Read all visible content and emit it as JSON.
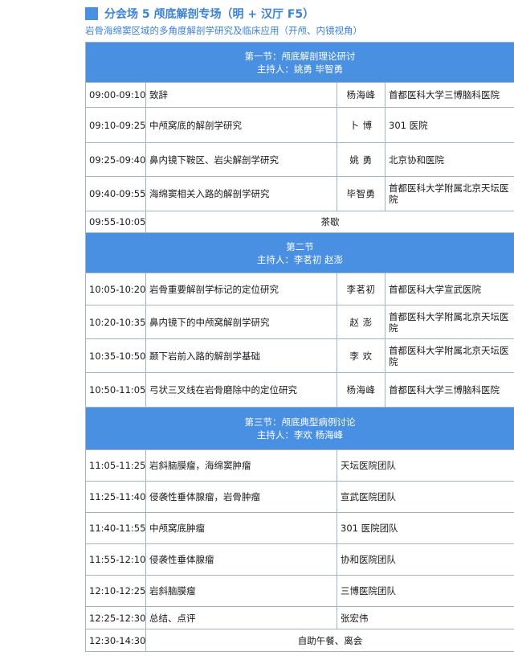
{
  "header": {
    "title": "分会场 5   颅底解剖专场（明 + 汉厅  F5）",
    "subtitle": "岩骨海绵窦区域的多角度解剖学研究及临床应用（开颅、内镜视角）"
  },
  "sections": [
    {
      "title": "第一节：颅底解剖理论研讨",
      "hosts": "主持人：姚勇  毕智勇",
      "rows": [
        {
          "time": "09:00-09:10",
          "topic": "致辞",
          "speaker": "杨海峰",
          "inst": "首都医科大学三博脑科医院"
        },
        {
          "time": "09:10-09:25",
          "topic": "中颅窝底的解剖学研究",
          "speaker": "卜  博",
          "inst": "301 医院"
        },
        {
          "time": "09:25-09:40",
          "topic": "鼻内镜下鞍区、岩尖解剖学研究",
          "speaker": "姚  勇",
          "inst": "北京协和医院"
        },
        {
          "time": "09:40-09:55",
          "topic": "海绵窦相关入路的解剖学研究",
          "speaker": "毕智勇",
          "inst": "首都医科大学附属北京天坛医院"
        }
      ],
      "break": {
        "time": "09:55-10:05",
        "label": "茶歇"
      }
    },
    {
      "title": "第二节",
      "hosts": "主持人：李茗初  赵澎",
      "rows": [
        {
          "time": "10:05-10:20",
          "topic": "岩骨重要解剖学标记的定位研究",
          "speaker": "李茗初",
          "inst": "首都医科大学宣武医院"
        },
        {
          "time": "10:20-10:35",
          "topic": "鼻内镜下的中颅窝解剖学研究",
          "speaker": "赵  澎",
          "inst": "首都医科大学附属北京天坛医院"
        },
        {
          "time": "10:35-10:50",
          "topic": "颞下岩前入路的解剖学基础",
          "speaker": "李  欢",
          "inst": "首都医科大学附属北京天坛医院"
        },
        {
          "time": "10:50-11:05",
          "topic": "弓状三叉线在岩骨磨除中的定位研究",
          "speaker": "杨海峰",
          "inst": "首都医科大学三博脑科医院"
        }
      ]
    },
    {
      "title": "第三节：颅底典型病例讨论",
      "hosts": "主持人：李欢  杨海峰",
      "rows": [
        {
          "time": "11:05-11:25",
          "topic": "岩斜脑膜瘤，海绵窦肿瘤",
          "team": "天坛医院团队"
        },
        {
          "time": "11:25-11:40",
          "topic": "侵袭性垂体腺瘤，岩骨肿瘤",
          "team": "宣武医院团队"
        },
        {
          "time": "11:40-11:55",
          "topic": "中颅窝底肿瘤",
          "team": "301 医院团队"
        },
        {
          "time": "11:55-12:10",
          "topic": "侵袭性垂体腺瘤",
          "team": "协和医院团队"
        },
        {
          "time": "12:10-12:25",
          "topic": "岩斜脑膜瘤",
          "team": "三博医院团队"
        },
        {
          "time": "12:25-12:30",
          "topic": "总结、点评",
          "team": "张宏伟"
        }
      ],
      "closing": {
        "time": "12:30-14:30",
        "label": "自助午餐、离会"
      }
    }
  ]
}
